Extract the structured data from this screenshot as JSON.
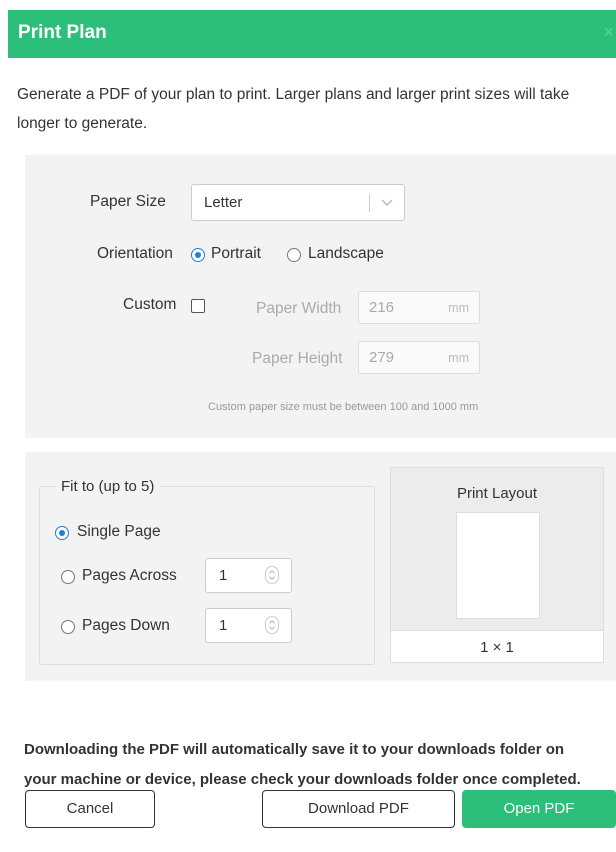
{
  "dialog": {
    "title": "Print Plan",
    "close_icon": "×",
    "description": "Generate a PDF of your plan to print. Larger plans and larger print sizes will take longer to generate."
  },
  "paper": {
    "size_label": "Paper Size",
    "size_value": "Letter",
    "orientation_label": "Orientation",
    "orientation_options": [
      "Portrait",
      "Landscape"
    ],
    "orientation_selected": "Portrait",
    "custom_label": "Custom",
    "custom_checked": false,
    "width_label": "Paper Width",
    "width_value": "216",
    "height_label": "Paper Height",
    "height_value": "279",
    "unit": "mm",
    "hint": "Custom paper size must be between 100 and 1000 mm"
  },
  "fit": {
    "legend": "Fit to (up to 5)",
    "single_page_label": "Single Page",
    "pages_across_label": "Pages Across",
    "pages_across_value": "1",
    "pages_down_label": "Pages Down",
    "pages_down_value": "1",
    "selected": "Single Page"
  },
  "layout": {
    "title": "Print Layout",
    "grid_label": "1 × 1"
  },
  "notice": {
    "line1": "Downloading the PDF will automatically save it to your downloads folder on",
    "line2": "your machine or device, please check your downloads folder once completed."
  },
  "buttons": {
    "cancel": "Cancel",
    "download": "Download PDF",
    "open": "Open PDF"
  },
  "colors": {
    "brand_green": "#2bbf7a",
    "radio_blue": "#1f7fd6"
  }
}
